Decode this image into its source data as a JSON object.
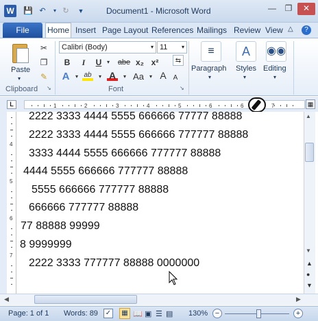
{
  "window": {
    "title": "Document1 - Microsoft Word",
    "logo": "W"
  },
  "tabs": [
    "File",
    "Home",
    "Insert",
    "Page Layout",
    "References",
    "Mailings",
    "Review",
    "View"
  ],
  "ribbon": {
    "clipboard": {
      "label": "Clipboard",
      "paste": "Paste"
    },
    "font": {
      "label": "Font",
      "family": "Calibri (Body)",
      "size": "11",
      "bold": "B",
      "italic": "I",
      "underline": "U",
      "strike": "abe",
      "subscript": "x₂",
      "superscript": "x²",
      "changecase": "Aa",
      "grow": "A",
      "shrink": "A"
    },
    "paragraph": "Paragraph",
    "styles": "Styles",
    "editing": "Editing"
  },
  "document": {
    "lines": [
      "2222  3333 4444   5555  666666  77777  88888",
      "2222  3333 4444   5555  666666  777777  88888",
      "3333 4444   5555  666666  777777  88888",
      "4444   5555  666666 777777  88888",
      "5555  666666 777777  88888",
      "666666 777777  88888",
      "77  88888 99999",
      "8  9999999",
      "2222  3333 777777  88888  0000000"
    ]
  },
  "status": {
    "page": "Page: 1 of 1",
    "words": "Words: 89",
    "zoom": "130%"
  }
}
